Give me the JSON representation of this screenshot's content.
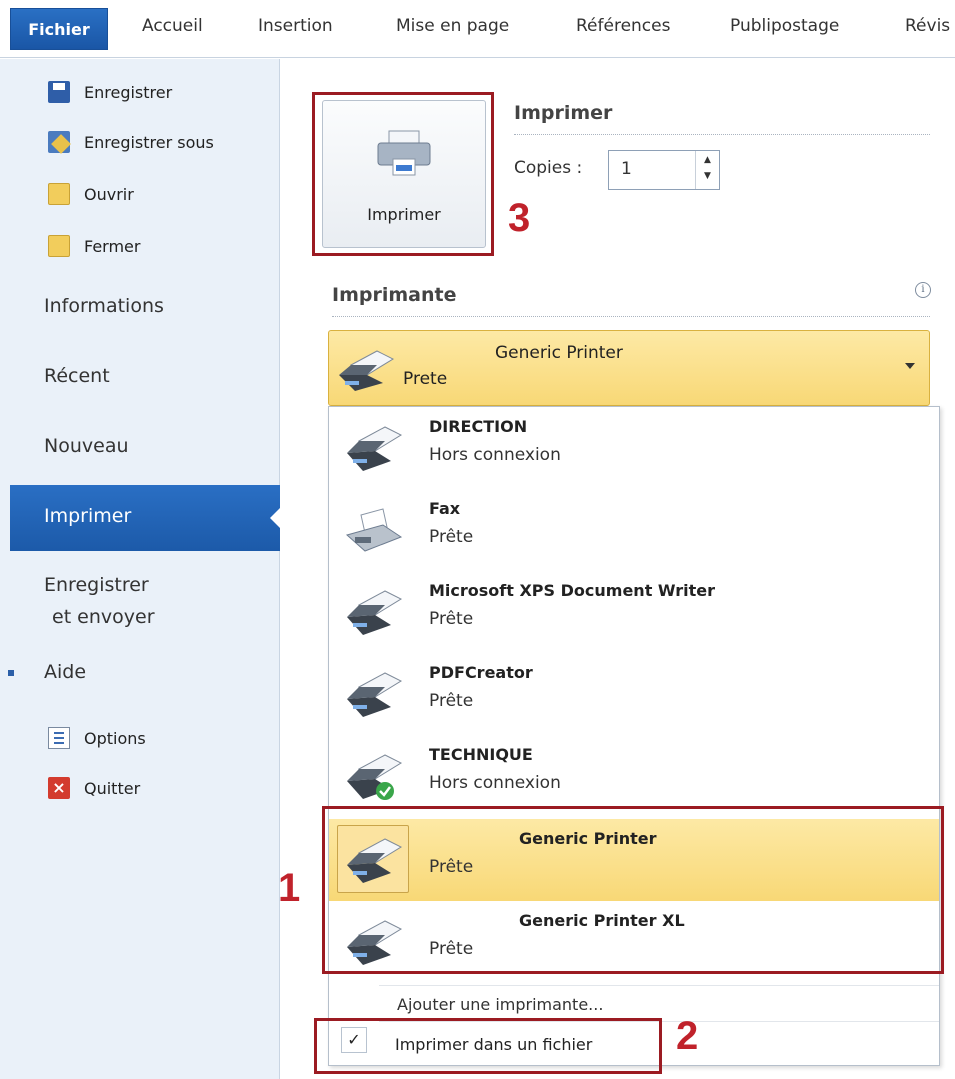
{
  "ribbon": {
    "file_tab": "Fichier",
    "tabs": [
      "Accueil",
      "Insertion",
      "Mise en page",
      "Références",
      "Publipostage",
      "Révis"
    ]
  },
  "backstage": {
    "commands": {
      "save": "Enregistrer",
      "save_as": "Enregistrer sous",
      "open": "Ouvrir",
      "close": "Fermer",
      "options": "Options",
      "quit": "Quitter"
    },
    "tabs": {
      "info": "Informations",
      "recent": "Récent",
      "new": "Nouveau",
      "print": "Imprimer",
      "save_send_line1": "Enregistrer",
      "save_send_line2": "et envoyer",
      "help": "Aide"
    }
  },
  "print": {
    "section_title": "Imprimer",
    "button_label": "Imprimer",
    "copies_label": "Copies :",
    "copies_value": "1",
    "printer_section": "Imprimante",
    "selected_printer": {
      "name": "Generic Printer",
      "status": "Prete"
    },
    "printers": [
      {
        "name": "DIRECTION",
        "status": "Hors connexion"
      },
      {
        "name": "Fax",
        "status": "Prête"
      },
      {
        "name": "Microsoft XPS Document Writer",
        "status": "Prête"
      },
      {
        "name": "PDFCreator",
        "status": "Prête"
      },
      {
        "name": "TECHNIQUE",
        "status": "Hors connexion"
      },
      {
        "name": "Generic Printer",
        "status": "Prête"
      },
      {
        "name": "Generic Printer XL",
        "status": "Prête"
      }
    ],
    "add_printer": "Ajouter une imprimante...",
    "print_to_file": "Imprimer dans un fichier",
    "print_to_file_checked": "✓"
  },
  "annotations": {
    "step1": "1",
    "step2": "2",
    "step3": "3"
  },
  "colors": {
    "accent": "#1c5aa9",
    "highlight": "#f8d876",
    "callout": "#9b1b22"
  }
}
